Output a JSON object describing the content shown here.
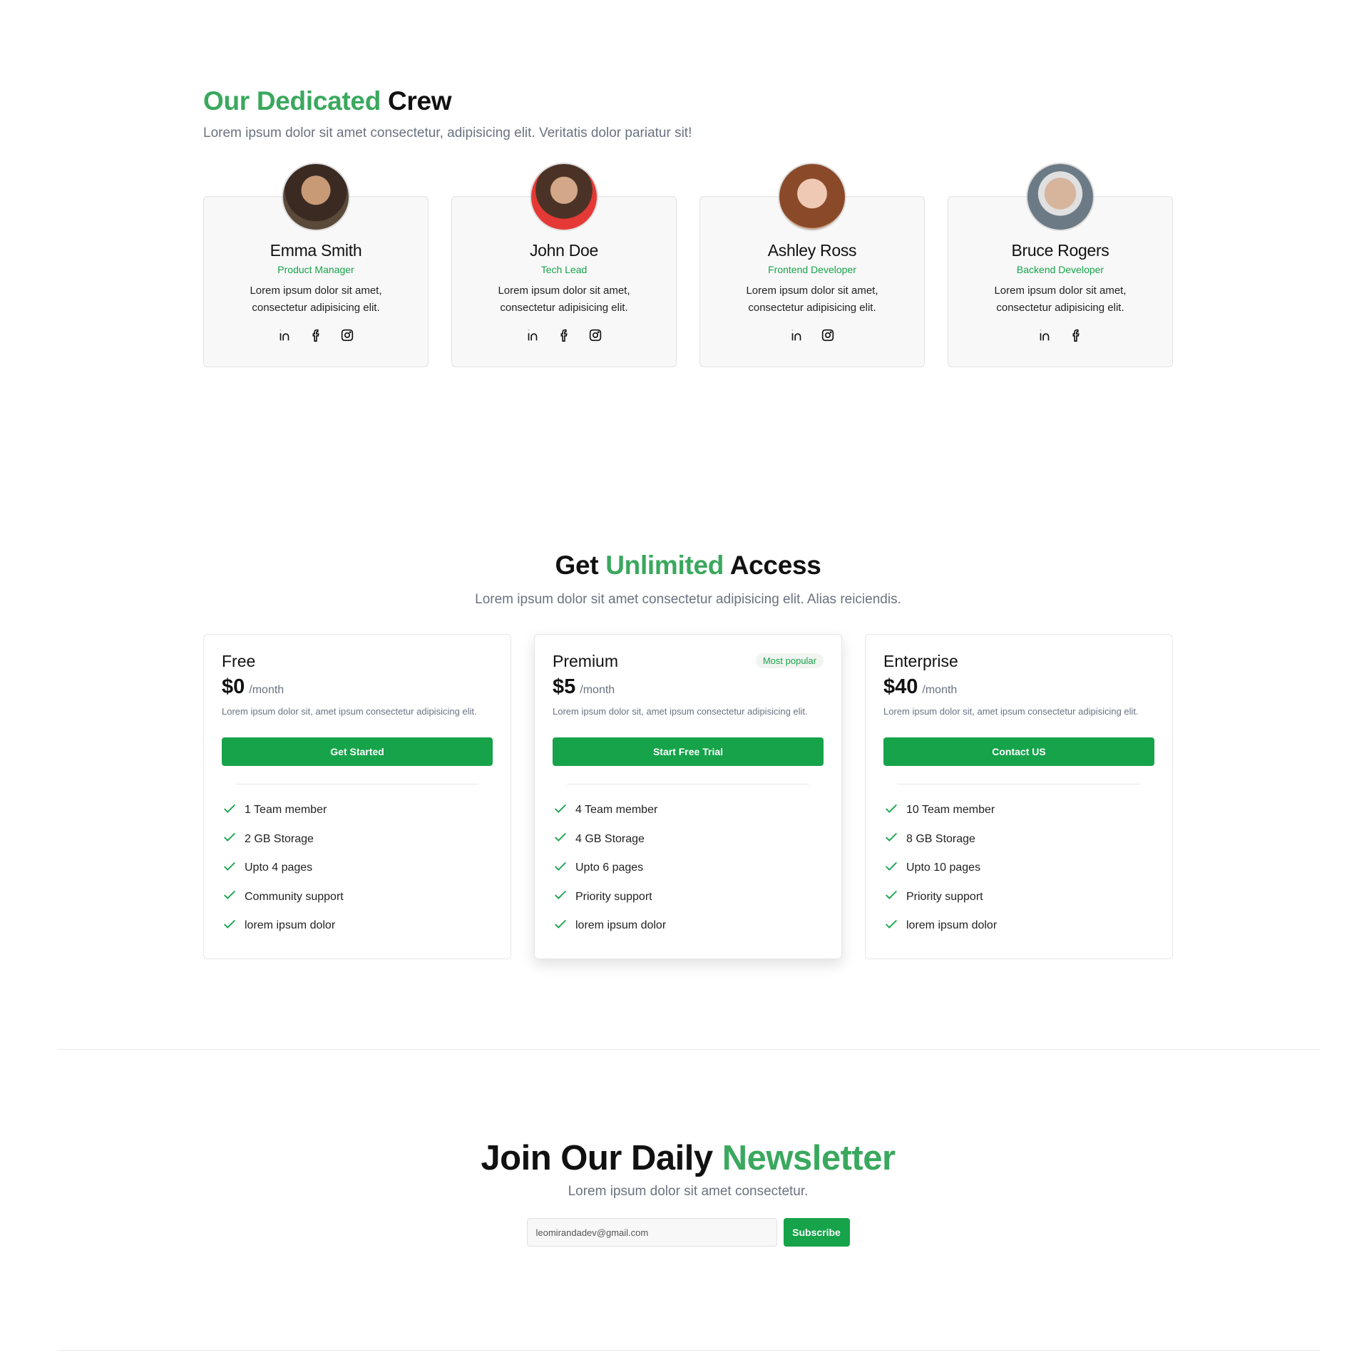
{
  "team": {
    "title_accent": "Our Dedicated",
    "title_rest": "Crew",
    "subtitle": "Lorem ipsum dolor sit amet consectetur, adipisicing elit. Veritatis dolor pariatur sit!",
    "members": [
      {
        "name": "Emma Smith",
        "role": "Product Manager",
        "desc": "Lorem ipsum dolor sit amet, consectetur adipisicing elit.",
        "socials": [
          "linkedin-icon",
          "facebook-icon",
          "instagram-icon"
        ]
      },
      {
        "name": "John Doe",
        "role": "Tech Lead",
        "desc": "Lorem ipsum dolor sit amet, consectetur adipisicing elit.",
        "socials": [
          "linkedin-icon",
          "facebook-icon",
          "instagram-icon"
        ]
      },
      {
        "name": "Ashley Ross",
        "role": "Frontend Developer",
        "desc": "Lorem ipsum dolor sit amet, consectetur adipisicing elit.",
        "socials": [
          "linkedin-icon",
          "instagram-icon"
        ]
      },
      {
        "name": "Bruce Rogers",
        "role": "Backend Developer",
        "desc": "Lorem ipsum dolor sit amet, consectetur adipisicing elit.",
        "socials": [
          "linkedin-icon",
          "facebook-icon"
        ]
      }
    ]
  },
  "pricing": {
    "title_pre": "Get",
    "title_accent": "Unlimited",
    "title_post": "Access",
    "subtitle": "Lorem ipsum dolor sit amet consectetur adipisicing elit. Alias reiciendis.",
    "plans": [
      {
        "name": "Free",
        "price": "$0",
        "period": "/month",
        "desc": "Lorem ipsum dolor sit, amet ipsum consectetur adipisicing elit.",
        "button": "Get Started",
        "features": [
          "1 Team member",
          "2 GB Storage",
          "Upto 4 pages",
          "Community support",
          "lorem ipsum dolor"
        ]
      },
      {
        "name": "Premium",
        "price": "$5",
        "period": "/month",
        "badge": "Most popular",
        "desc": "Lorem ipsum dolor sit, amet ipsum consectetur adipisicing elit.",
        "button": "Start Free Trial",
        "features": [
          "4 Team member",
          "4 GB Storage",
          "Upto 6 pages",
          "Priority support",
          "lorem ipsum dolor"
        ]
      },
      {
        "name": "Enterprise",
        "price": "$40",
        "period": "/month",
        "desc": "Lorem ipsum dolor sit, amet ipsum consectetur adipisicing elit.",
        "button": "Contact US",
        "features": [
          "10 Team member",
          "8 GB Storage",
          "Upto 10 pages",
          "Priority support",
          "lorem ipsum dolor"
        ]
      }
    ]
  },
  "newsletter": {
    "title_pre": "Join Our Daily",
    "title_accent": "Newsletter",
    "subtitle": "Lorem ipsum dolor sit amet consectetur.",
    "email_value": "leomirandadev@gmail.com",
    "button": "Subscribe"
  },
  "colors": {
    "accent": "#3aa85e",
    "button": "#16a34a"
  }
}
